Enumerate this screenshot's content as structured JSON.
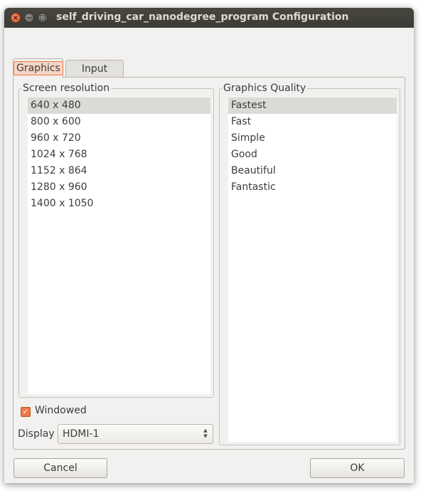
{
  "window": {
    "title": "self_driving_car_nanodegree_program Configuration",
    "controls": {
      "close": "×",
      "minimize": "−",
      "maximize": "□"
    }
  },
  "tabs": [
    {
      "label": "Graphics",
      "active": true
    },
    {
      "label": "Input",
      "active": false
    }
  ],
  "resolution": {
    "label": "Screen resolution",
    "items": [
      "640 x 480",
      "800 x 600",
      "960 x 720",
      "1024 x 768",
      "1152 x 864",
      "1280 x 960",
      "1400 x 1050"
    ],
    "selected": "640 x 480"
  },
  "quality": {
    "label": "Graphics Quality",
    "items": [
      "Fastest",
      "Fast",
      "Simple",
      "Good",
      "Beautiful",
      "Fantastic"
    ],
    "selected": "Fastest"
  },
  "windowed": {
    "label": "Windowed",
    "checked": true,
    "mark": "✓"
  },
  "display": {
    "label": "Display",
    "value": "HDMI-1",
    "arrow_up": "▲",
    "arrow_down": "▼"
  },
  "buttons": {
    "cancel": "Cancel",
    "ok": "OK"
  },
  "colors": {
    "accent": "#f07746",
    "titlebar": "#3c3b37",
    "window_bg": "#f2f1f0"
  }
}
